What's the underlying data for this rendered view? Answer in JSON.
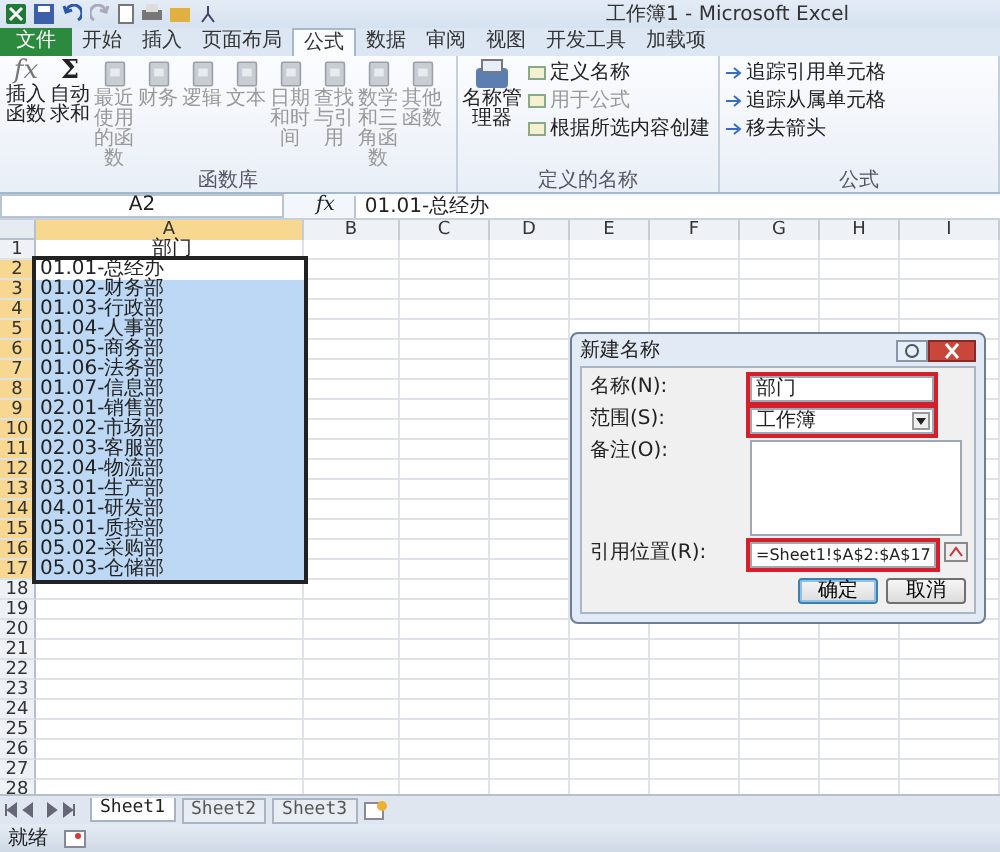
{
  "window": {
    "title": "工作簿1 - Microsoft Excel"
  },
  "tabs": [
    {
      "label": "文件",
      "kind": "file",
      "selected": false
    },
    {
      "label": "开始",
      "kind": "tab",
      "selected": false
    },
    {
      "label": "插入",
      "kind": "tab",
      "selected": false
    },
    {
      "label": "页面布局",
      "kind": "tab",
      "selected": false
    },
    {
      "label": "公式",
      "kind": "tab",
      "selected": true
    },
    {
      "label": "数据",
      "kind": "tab",
      "selected": false
    },
    {
      "label": "审阅",
      "kind": "tab",
      "selected": false
    },
    {
      "label": "视图",
      "kind": "tab",
      "selected": false
    },
    {
      "label": "开发工具",
      "kind": "tab",
      "selected": false
    },
    {
      "label": "加载项",
      "kind": "tab",
      "selected": false
    }
  ],
  "ribbon": {
    "function_library": {
      "label": "函数库",
      "buttons": [
        {
          "label": "插入函数",
          "kind": "fx",
          "glyph": "fx",
          "disabled": false
        },
        {
          "label": "自动求和",
          "kind": "sigma",
          "glyph": "Σ",
          "disabled": false
        },
        {
          "label": "最近使用的函数",
          "kind": "book",
          "disabled": true
        },
        {
          "label": "财务",
          "kind": "book",
          "disabled": true
        },
        {
          "label": "逻辑",
          "kind": "book",
          "disabled": true
        },
        {
          "label": "文本",
          "kind": "book",
          "disabled": true
        },
        {
          "label": "日期和时间",
          "kind": "book",
          "disabled": true
        },
        {
          "label": "查找与引用",
          "kind": "book",
          "disabled": true
        },
        {
          "label": "数学和三角函数",
          "kind": "book",
          "disabled": true
        },
        {
          "label": "其他函数",
          "kind": "book",
          "disabled": true
        }
      ]
    },
    "defined_names": {
      "label": "定义的名称",
      "manager": "名称管理器",
      "items": [
        {
          "label": "定义名称",
          "disabled": false
        },
        {
          "label": "用于公式",
          "disabled": true
        },
        {
          "label": "根据所选内容创建",
          "disabled": false
        }
      ]
    },
    "auditing": {
      "label": "公式",
      "items": [
        {
          "label": "追踪引用单元格",
          "disabled": false
        },
        {
          "label": "追踪从属单元格",
          "disabled": false
        },
        {
          "label": "移去箭头",
          "disabled": false
        }
      ]
    }
  },
  "formula_bar": {
    "name_box": "A2",
    "fx": "fx",
    "value": "01.01-总经办"
  },
  "columns": [
    {
      "label": "A",
      "selected": true
    },
    {
      "label": "B",
      "selected": false
    },
    {
      "label": "C",
      "selected": false
    },
    {
      "label": "D",
      "selected": false
    },
    {
      "label": "E",
      "selected": false
    },
    {
      "label": "F",
      "selected": false
    },
    {
      "label": "G",
      "selected": false
    },
    {
      "label": "H",
      "selected": false
    },
    {
      "label": "I",
      "selected": false
    }
  ],
  "rows": [
    {
      "num": "1",
      "a": "部门",
      "selected": false,
      "active": false
    },
    {
      "num": "2",
      "a": "01.01-总经办",
      "selected": true,
      "active": true
    },
    {
      "num": "3",
      "a": "01.02-财务部",
      "selected": true,
      "active": false
    },
    {
      "num": "4",
      "a": "01.03-行政部",
      "selected": true,
      "active": false
    },
    {
      "num": "5",
      "a": "01.04-人事部",
      "selected": true,
      "active": false
    },
    {
      "num": "6",
      "a": "01.05-商务部",
      "selected": true,
      "active": false
    },
    {
      "num": "7",
      "a": "01.06-法务部",
      "selected": true,
      "active": false
    },
    {
      "num": "8",
      "a": "01.07-信息部",
      "selected": true,
      "active": false
    },
    {
      "num": "9",
      "a": "02.01-销售部",
      "selected": true,
      "active": false
    },
    {
      "num": "10",
      "a": "02.02-市场部",
      "selected": true,
      "active": false
    },
    {
      "num": "11",
      "a": "02.03-客服部",
      "selected": true,
      "active": false
    },
    {
      "num": "12",
      "a": "02.04-物流部",
      "selected": true,
      "active": false
    },
    {
      "num": "13",
      "a": "03.01-生产部",
      "selected": true,
      "active": false
    },
    {
      "num": "14",
      "a": "04.01-研发部",
      "selected": true,
      "active": false
    },
    {
      "num": "15",
      "a": "05.01-质控部",
      "selected": true,
      "active": false
    },
    {
      "num": "16",
      "a": "05.02-采购部",
      "selected": true,
      "active": false
    },
    {
      "num": "17",
      "a": "05.03-仓储部",
      "selected": true,
      "active": false
    },
    {
      "num": "18",
      "selected": false,
      "active": false
    },
    {
      "num": "19",
      "selected": false,
      "active": false
    },
    {
      "num": "20",
      "selected": false,
      "active": false
    },
    {
      "num": "21",
      "selected": false,
      "active": false
    },
    {
      "num": "22",
      "selected": false,
      "active": false
    },
    {
      "num": "23",
      "selected": false,
      "active": false
    },
    {
      "num": "24",
      "selected": false,
      "active": false
    },
    {
      "num": "25",
      "selected": false,
      "active": false
    },
    {
      "num": "26",
      "selected": false,
      "active": false
    },
    {
      "num": "27",
      "selected": false,
      "active": false
    },
    {
      "num": "28",
      "selected": false,
      "active": false
    }
  ],
  "dialog": {
    "title": "新建名称",
    "fields": [
      {
        "label": "名称(N):",
        "kind": "text",
        "value": "部门",
        "highlighted": true
      },
      {
        "label": "范围(S):",
        "kind": "select",
        "value": "工作簿",
        "highlighted": true
      },
      {
        "label": "备注(O):",
        "kind": "memo",
        "highlighted": false
      },
      {
        "label": "引用位置(R):",
        "kind": "ref",
        "value": "=Sheet1!$A$2:$A$17",
        "highlighted": true
      }
    ],
    "buttons": [
      {
        "label": "确定",
        "default": true
      },
      {
        "label": "取消",
        "default": false
      }
    ]
  },
  "sheets": [
    {
      "label": "Sheet1",
      "selected": true
    },
    {
      "label": "Sheet2",
      "selected": false
    },
    {
      "label": "Sheet3",
      "selected": false
    }
  ],
  "status_bar": {
    "text": "就绪"
  }
}
